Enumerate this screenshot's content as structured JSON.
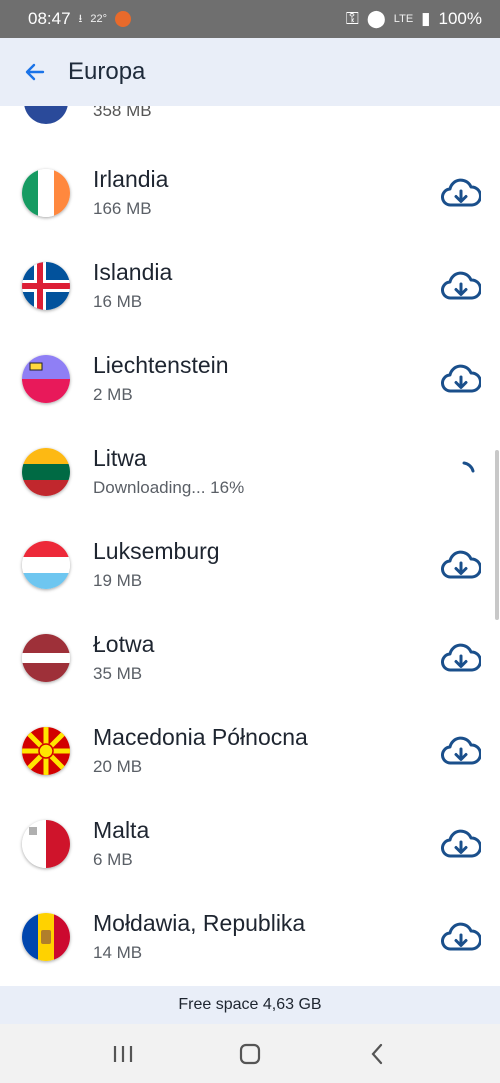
{
  "status_bar": {
    "time": "08:47",
    "temperature": "22°",
    "network": "LTE",
    "battery": "100%"
  },
  "header": {
    "title": "Europa"
  },
  "partial_item": {
    "size": "358 MB"
  },
  "countries": [
    {
      "name": "Irlandia",
      "size": "166 MB",
      "flag": "ireland",
      "state": "download"
    },
    {
      "name": "Islandia",
      "size": "16 MB",
      "flag": "iceland",
      "state": "download"
    },
    {
      "name": "Liechtenstein",
      "size": "2 MB",
      "flag": "liechtenstein",
      "state": "download"
    },
    {
      "name": "Litwa",
      "size": "Downloading... 16%",
      "flag": "lithuania",
      "state": "downloading",
      "progress": 0.16
    },
    {
      "name": "Luksemburg",
      "size": "19 MB",
      "flag": "luxembourg",
      "state": "download"
    },
    {
      "name": "Łotwa",
      "size": "35 MB",
      "flag": "latvia",
      "state": "download"
    },
    {
      "name": "Macedonia Północna",
      "size": "20 MB",
      "flag": "north-macedonia",
      "state": "download"
    },
    {
      "name": "Malta",
      "size": "6 MB",
      "flag": "malta",
      "state": "download"
    },
    {
      "name": "Mołdawia, Republika",
      "size": "14 MB",
      "flag": "moldova",
      "state": "download"
    }
  ],
  "footer": {
    "free_space": "Free space 4,63 GB"
  },
  "colors": {
    "accent": "#1a4f8b",
    "appbar_bg": "#e9eef8"
  }
}
